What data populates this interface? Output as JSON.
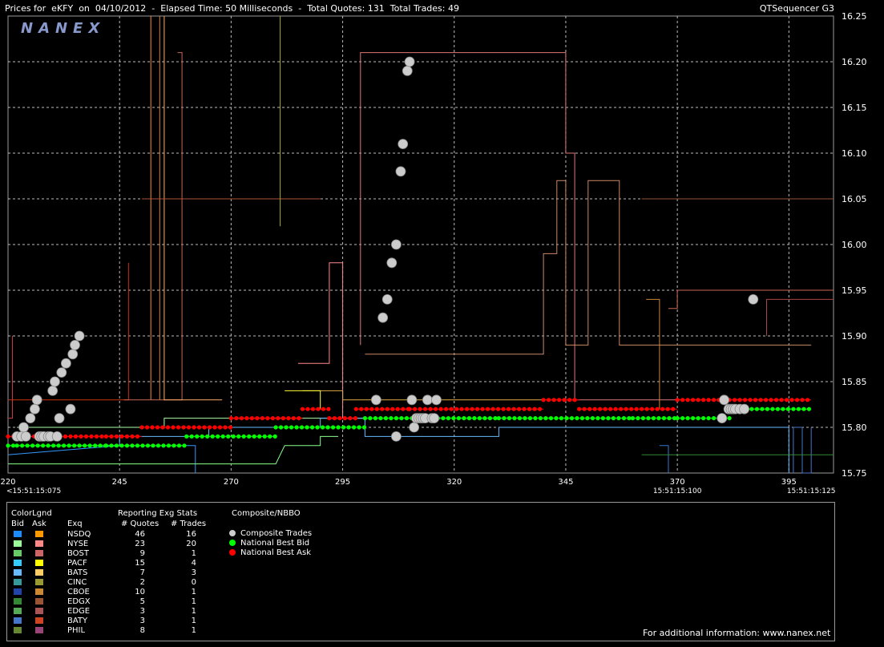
{
  "header": {
    "title": "Prices for  eKFY  on  04/10/2012  -  Elapsed Time: 50 Milliseconds  -  Total Quotes: 131  Total Trades: 49",
    "app": "QTSequencer G3"
  },
  "watermark": "NANEX",
  "colors": {
    "bid": "#00ff00",
    "ask": "#ff0000",
    "trade": "#cccccc",
    "nasdaq_bid": "#3399ff",
    "nyse_bid": "#88ff88",
    "arca_ask": "#ffff33"
  },
  "chart_data": {
    "type": "line",
    "xlabel": "",
    "ylabel": "",
    "xlim": [
      220,
      405
    ],
    "ylim": [
      15.75,
      16.25
    ],
    "x_ticks": [
      "220",
      "245",
      "270",
      "295",
      "320",
      "345",
      "370",
      "395"
    ],
    "x_time_labels": [
      "<15:51:15:075",
      "15:51:15:100",
      "15:51:15:125"
    ],
    "y_ticks": [
      "16.25",
      "16.20",
      "16.15",
      "16.10",
      "16.05",
      "16.00",
      "15.95",
      "15.90",
      "15.85",
      "15.80",
      "15.75"
    ],
    "grid": true,
    "series": [
      {
        "name": "Composite Trades",
        "type": "scatter",
        "color": "#cccccc",
        "points": [
          [
            222,
            15.79
          ],
          [
            223,
            15.79
          ],
          [
            223.5,
            15.8
          ],
          [
            224,
            15.79
          ],
          [
            225,
            15.81
          ],
          [
            226,
            15.82
          ],
          [
            226.5,
            15.83
          ],
          [
            227,
            15.79
          ],
          [
            227.5,
            15.79
          ],
          [
            228,
            15.79
          ],
          [
            229,
            15.79
          ],
          [
            229.5,
            15.79
          ],
          [
            230,
            15.84
          ],
          [
            230.5,
            15.85
          ],
          [
            231,
            15.79
          ],
          [
            231.5,
            15.81
          ],
          [
            232,
            15.86
          ],
          [
            233,
            15.87
          ],
          [
            234,
            15.82
          ],
          [
            234.5,
            15.88
          ],
          [
            235,
            15.89
          ],
          [
            236,
            15.9
          ],
          [
            302.5,
            15.83
          ],
          [
            304,
            15.92
          ],
          [
            305,
            15.94
          ],
          [
            306,
            15.98
          ],
          [
            307,
            16.0
          ],
          [
            307,
            15.79
          ],
          [
            308,
            16.08
          ],
          [
            308.5,
            16.11
          ],
          [
            309.5,
            16.19
          ],
          [
            310,
            16.2
          ],
          [
            310.5,
            15.83
          ],
          [
            311,
            15.8
          ],
          [
            311.5,
            15.81
          ],
          [
            312,
            15.81
          ],
          [
            312.5,
            15.81
          ],
          [
            313,
            15.81
          ],
          [
            313.5,
            15.81
          ],
          [
            314,
            15.83
          ],
          [
            315,
            15.81
          ],
          [
            315.5,
            15.81
          ],
          [
            316,
            15.83
          ],
          [
            380,
            15.81
          ],
          [
            380.5,
            15.83
          ],
          [
            381.5,
            15.82
          ],
          [
            382,
            15.82
          ],
          [
            382.5,
            15.82
          ],
          [
            383,
            15.82
          ],
          [
            384,
            15.82
          ],
          [
            385,
            15.82
          ],
          [
            387,
            15.94
          ]
        ]
      },
      {
        "name": "National Best Bid",
        "type": "step",
        "color": "#00ff00",
        "points": [
          [
            220,
            15.78
          ],
          [
            222,
            15.78
          ],
          [
            242,
            15.78
          ],
          [
            260,
            15.79
          ],
          [
            280,
            15.8
          ],
          [
            300,
            15.81
          ],
          [
            330,
            15.81
          ],
          [
            360,
            15.81
          ],
          [
            370,
            15.81
          ],
          [
            382,
            15.82
          ],
          [
            400,
            15.82
          ]
        ]
      },
      {
        "name": "National Best Ask",
        "type": "step",
        "color": "#ff0000",
        "points": [
          [
            220,
            15.79
          ],
          [
            242,
            15.79
          ],
          [
            250,
            15.8
          ],
          [
            270,
            15.81
          ],
          [
            286,
            15.82
          ],
          [
            292,
            15.81
          ],
          [
            298,
            15.82
          ],
          [
            310,
            15.82
          ],
          [
            340,
            15.83
          ],
          [
            348,
            15.82
          ],
          [
            370,
            15.83
          ],
          [
            384,
            15.83
          ],
          [
            400,
            15.83
          ]
        ]
      }
    ]
  },
  "legend": {
    "color_legend_title": "ColorLgnd",
    "bid_label": "Bid",
    "ask_label": "Ask",
    "exch_label": "Exq",
    "stats_title": "Reporting Exg Stats",
    "quotes_label": "# Quotes",
    "trades_label": "# Trades",
    "composite_title": "Composite/NBBO",
    "composite_items": [
      {
        "label": "Composite Trades",
        "color": "#cccccc"
      },
      {
        "label": "National Best Bid",
        "color": "#00ff00"
      },
      {
        "label": "National Best Ask",
        "color": "#ff0000"
      }
    ],
    "exchanges": [
      {
        "name": "NSDQ",
        "quotes": "46",
        "trades": "16",
        "bid_color": "#1a8cff",
        "ask_color": "#ff9900"
      },
      {
        "name": "NYSE",
        "quotes": "23",
        "trades": "20",
        "bid_color": "#99ff99",
        "ask_color": "#ff8888"
      },
      {
        "name": "BOST",
        "quotes": "9",
        "trades": "1",
        "bid_color": "#66cc66",
        "ask_color": "#cc6666"
      },
      {
        "name": "PACF",
        "quotes": "15",
        "trades": "4",
        "bid_color": "#33ccff",
        "ask_color": "#ffff00"
      },
      {
        "name": "BATS",
        "quotes": "7",
        "trades": "3",
        "bid_color": "#66bbff",
        "ask_color": "#ffcc66"
      },
      {
        "name": "CINC",
        "quotes": "2",
        "trades": "0",
        "bid_color": "#339999",
        "ask_color": "#999933"
      },
      {
        "name": "CBOE",
        "quotes": "10",
        "trades": "1",
        "bid_color": "#2244aa",
        "ask_color": "#cc8833"
      },
      {
        "name": "EDGX",
        "quotes": "5",
        "trades": "1",
        "bid_color": "#338833",
        "ask_color": "#995533"
      },
      {
        "name": "EDGE",
        "quotes": "3",
        "trades": "1",
        "bid_color": "#55aa55",
        "ask_color": "#aa5555"
      },
      {
        "name": "BATY",
        "quotes": "3",
        "trades": "1",
        "bid_color": "#4477cc",
        "ask_color": "#cc4422"
      },
      {
        "name": "PHIL",
        "quotes": "8",
        "trades": "1",
        "bid_color": "#668833",
        "ask_color": "#994477"
      }
    ],
    "footer": "For additional information: www.nanex.net"
  }
}
